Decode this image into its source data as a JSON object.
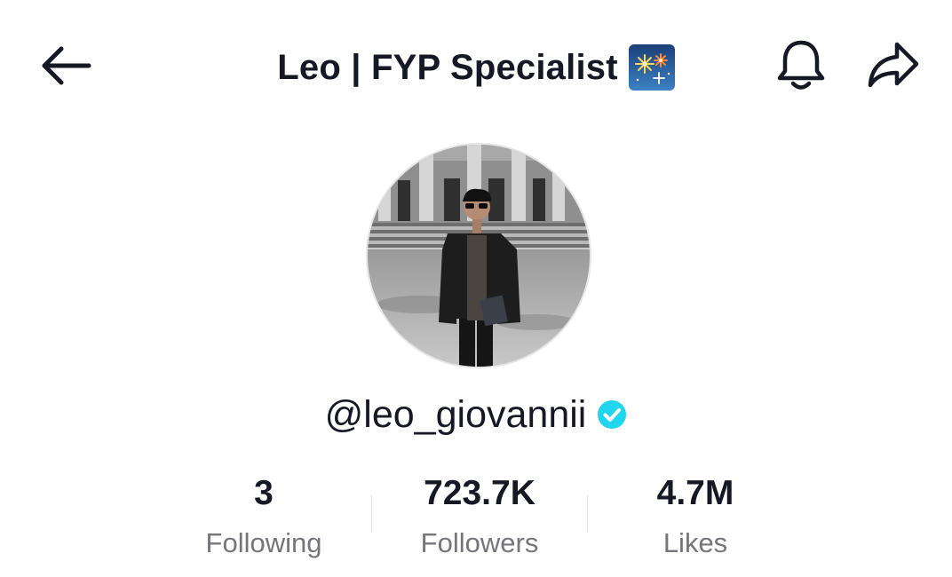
{
  "header": {
    "title": "Leo | FYP Specialist",
    "title_emoji": "fireworks-icon",
    "back_icon": "arrow-left-icon",
    "notification_icon": "bell-icon",
    "share_icon": "share-arrow-icon"
  },
  "profile": {
    "username": "@leo_giovannii",
    "verified_icon": "verified-badge-icon",
    "verified_color": "#20d5ec",
    "avatar_icon": "profile-photo"
  },
  "stats": [
    {
      "value": "3",
      "label": "Following"
    },
    {
      "value": "723.7K",
      "label": "Followers"
    },
    {
      "value": "4.7M",
      "label": "Likes"
    }
  ]
}
